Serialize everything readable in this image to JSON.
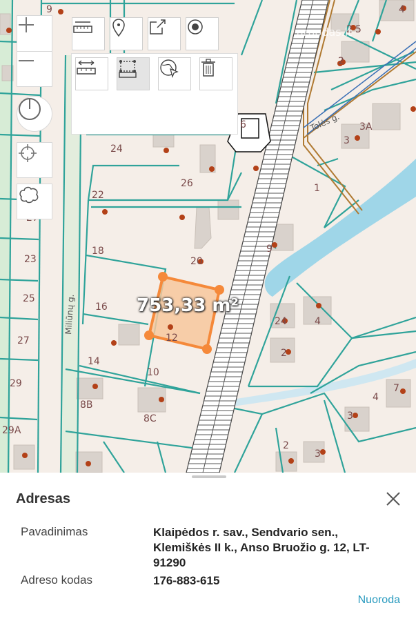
{
  "map": {
    "house_numbers": [
      "9",
      "4",
      "2",
      "24",
      "26",
      "22",
      "27",
      "1",
      "23",
      "18",
      "20",
      "25",
      "16",
      "9",
      "24",
      "4",
      "27",
      "14",
      "12",
      "10",
      "2",
      "29",
      "8B",
      "8C",
      "7",
      "3",
      "29A",
      "3A",
      "3",
      "2",
      "5",
      "6",
      "4",
      "2",
      "3"
    ],
    "street_labels": [
      "Miliūnų g.",
      "Tolės g."
    ],
    "area_label": "753,33 m²",
    "watermark": "aruodas.lt",
    "colors": {
      "parcel_line": "#2fa39a",
      "selected_parcel": "#f5893a",
      "water": "#9fd6e8",
      "building": "#d9d2cc"
    }
  },
  "controls": {
    "zoom_in_icon": "plus-icon",
    "zoom_out_icon": "minus-icon",
    "power_icon": "power-icon",
    "locate_icon": "crosshair-icon",
    "shape_icon": "cloud-shape-icon"
  },
  "toolbar": {
    "row1": [
      "measure-distance-icon",
      "map-pin-icon",
      "share-icon",
      "record-icon"
    ],
    "row2": [
      "measure-width-icon",
      "measure-area-icon",
      "globe-cursor-icon",
      "trash-icon"
    ]
  },
  "panel": {
    "title": "Adresas",
    "rows": [
      {
        "label": "Pavadinimas",
        "value": "Klaipėdos r. sav., Sendvario sen., Klemiškės II k., Anso Bruožio g. 12, LT-91290"
      },
      {
        "label": "Adreso kodas",
        "value": "176-883-615"
      }
    ],
    "link": "Nuoroda"
  }
}
